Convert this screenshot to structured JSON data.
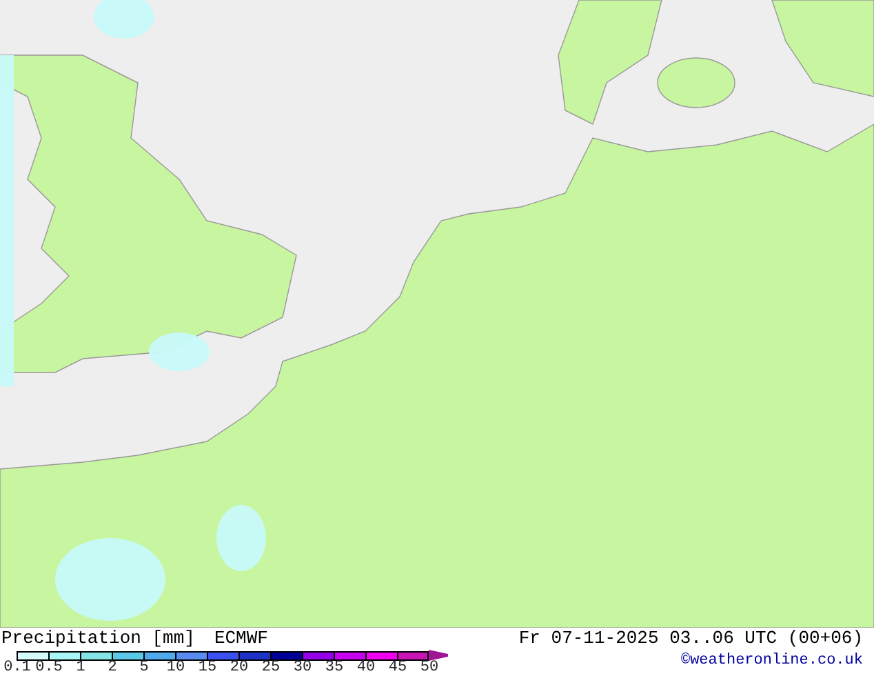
{
  "title": {
    "variable": "Precipitation [mm]",
    "model": "ECMWF"
  },
  "legend": {
    "bins": [
      {
        "color": "#d4fafa"
      },
      {
        "color": "#aaf5f5"
      },
      {
        "color": "#82e6e6"
      },
      {
        "color": "#5ac8e6"
      },
      {
        "color": "#50aaee"
      },
      {
        "color": "#5a8cf0"
      },
      {
        "color": "#3c50f0"
      },
      {
        "color": "#1e32c8"
      },
      {
        "color": "#000096"
      },
      {
        "color": "#9600e6"
      },
      {
        "color": "#c800f0"
      },
      {
        "color": "#f000f0"
      },
      {
        "color": "#c814b4"
      }
    ],
    "overflow": {
      "color": "#a01496"
    },
    "ticks": [
      "0.1",
      "0.5",
      "1",
      "2",
      "5",
      "10",
      "15",
      "20",
      "25",
      "30",
      "35",
      "40",
      "45",
      "50"
    ]
  },
  "valid_time": "Fr 07-11-2025 03..06 UTC (00+06)",
  "credit": "©weatheronline.co.uk"
}
